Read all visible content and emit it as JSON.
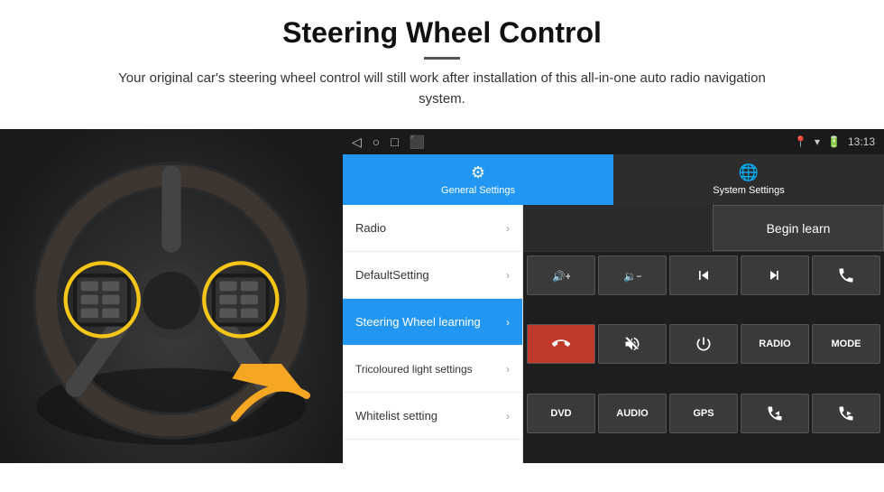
{
  "header": {
    "title": "Steering Wheel Control",
    "subtitle": "Your original car's steering wheel control will still work after installation of this all-in-one auto radio navigation system."
  },
  "statusBar": {
    "time": "13:13",
    "icons": [
      "◁",
      "○",
      "□",
      "⬛"
    ]
  },
  "tabs": [
    {
      "id": "general",
      "label": "General Settings",
      "icon": "⚙",
      "active": true
    },
    {
      "id": "system",
      "label": "System Settings",
      "icon": "🌐",
      "active": false
    }
  ],
  "menuItems": [
    {
      "id": "radio",
      "label": "Radio",
      "active": false
    },
    {
      "id": "default",
      "label": "DefaultSetting",
      "active": false
    },
    {
      "id": "steering",
      "label": "Steering Wheel learning",
      "active": true
    },
    {
      "id": "tricoloured",
      "label": "Tricoloured light settings",
      "active": false
    },
    {
      "id": "whitelist",
      "label": "Whitelist setting",
      "active": false
    }
  ],
  "controls": {
    "beginLearnLabel": "Begin learn",
    "buttons": [
      {
        "id": "vol-up",
        "symbol": "🔊+",
        "label": "volume up"
      },
      {
        "id": "vol-down",
        "symbol": "🔉−",
        "label": "volume down"
      },
      {
        "id": "prev",
        "symbol": "⏮",
        "label": "previous"
      },
      {
        "id": "next",
        "symbol": "⏭",
        "label": "next"
      },
      {
        "id": "call",
        "symbol": "📞",
        "label": "call"
      },
      {
        "id": "hang-up",
        "symbol": "📵",
        "label": "hang up"
      },
      {
        "id": "mute",
        "symbol": "🔇",
        "label": "mute"
      },
      {
        "id": "power",
        "symbol": "⏻",
        "label": "power"
      },
      {
        "id": "radio-btn",
        "symbol": "RADIO",
        "label": "radio"
      },
      {
        "id": "mode-btn",
        "symbol": "MODE",
        "label": "mode"
      },
      {
        "id": "dvd-btn",
        "symbol": "DVD",
        "label": "dvd"
      },
      {
        "id": "audio-btn",
        "symbol": "AUDIO",
        "label": "audio"
      },
      {
        "id": "gps-btn",
        "symbol": "GPS",
        "label": "gps"
      },
      {
        "id": "tel-prev",
        "symbol": "📞⏮",
        "label": "tel prev"
      },
      {
        "id": "tel-next",
        "symbol": "📞⏭",
        "label": "tel next"
      }
    ]
  }
}
